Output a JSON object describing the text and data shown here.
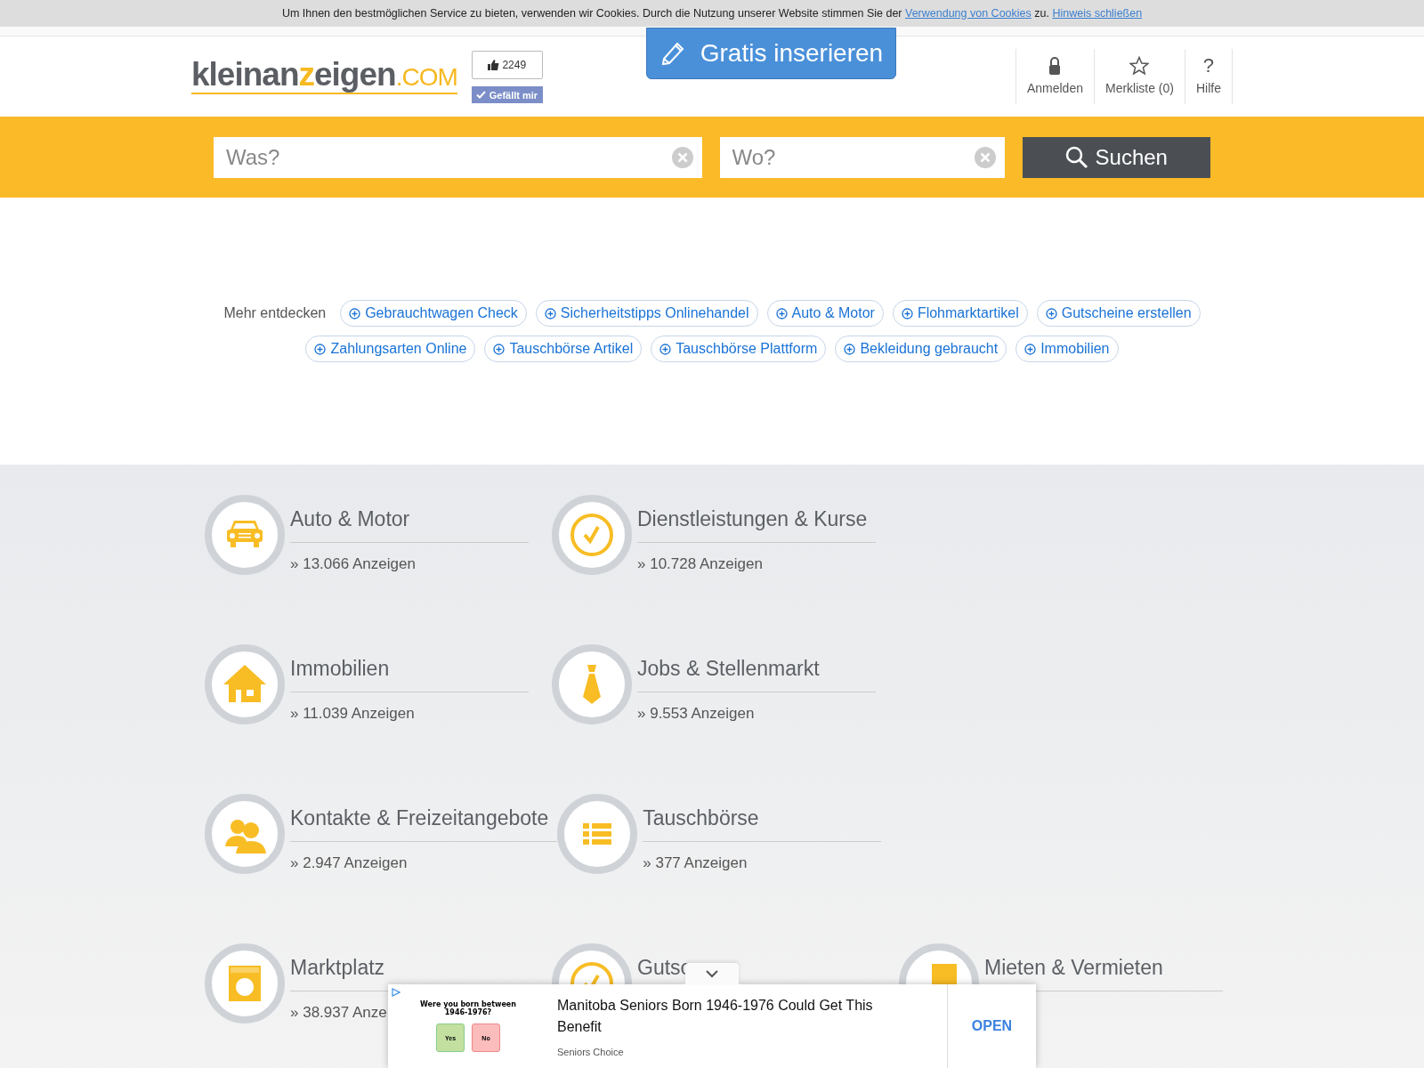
{
  "cookie_bar": {
    "text": "Um Ihnen den bestmöglichen Service zu bieten, verwenden wir Cookies. Durch die Nutzung unserer Website stimmen Sie der",
    "link": "Verwendung von Cookies",
    "after": "zu.",
    "close_link": "Hinweis schließen"
  },
  "header": {
    "logo": [
      "kleinan",
      "z",
      "eigen",
      ".COM"
    ],
    "like_count": "2249",
    "like_button": "Gefällt mir",
    "post_button": "Gratis inserieren",
    "nav": [
      {
        "kind": "lock",
        "label": "Anmelden"
      },
      {
        "kind": "star",
        "label": "Merkliste (0)"
      },
      {
        "kind": "glyph",
        "glyph": "?",
        "label": "Hilfe"
      }
    ]
  },
  "search": {
    "what_placeholder": "Was?",
    "where_placeholder": "Wo?",
    "button": "Suchen"
  },
  "discover": {
    "label": "Mehr entdecken",
    "chips": [
      "Gebrauchtwagen Check",
      "Sicherheitstipps Onlinehandel",
      "Auto & Motor",
      "Flohmarktartikel",
      "Gutscheine erstellen",
      "Zahlungsarten Online",
      "Tauschbörse Artikel",
      "Tauschbörse Plattform",
      "Bekleidung gebraucht",
      "Immobilien"
    ]
  },
  "categories": [
    [
      {
        "title": "Auto & Motor",
        "count": "» 13.066 Anzeigen"
      },
      {
        "title": "Dienstleistungen & Kurse",
        "count": "» 10.728 Anzeigen"
      }
    ],
    [
      {
        "title": "Immobilien",
        "count": "» 11.039 Anzeigen"
      },
      {
        "title": "Jobs & Stellenmarkt",
        "count": "» 9.553 Anzeigen"
      }
    ],
    [
      {
        "title": "Kontakte & Freizeitangebote",
        "count": "» 2.947 Anzeigen"
      },
      {
        "title": "Tauschbörse",
        "count": "» 377 Anzeigen"
      }
    ],
    [
      {
        "title": "Marktplatz",
        "count": "» 38.937 Anze"
      },
      {
        "title": "Gutsc"
      },
      {
        "title": "Mieten & Vermieten"
      }
    ]
  ],
  "ad": {
    "question": "Were you born between 1946-1976?",
    "yes": "Yes",
    "no": "No",
    "headline": "Manitoba Seniors Born 1946-1976 Could Get This Benefit",
    "advertiser": "Seniors Choice",
    "open": "OPEN"
  }
}
